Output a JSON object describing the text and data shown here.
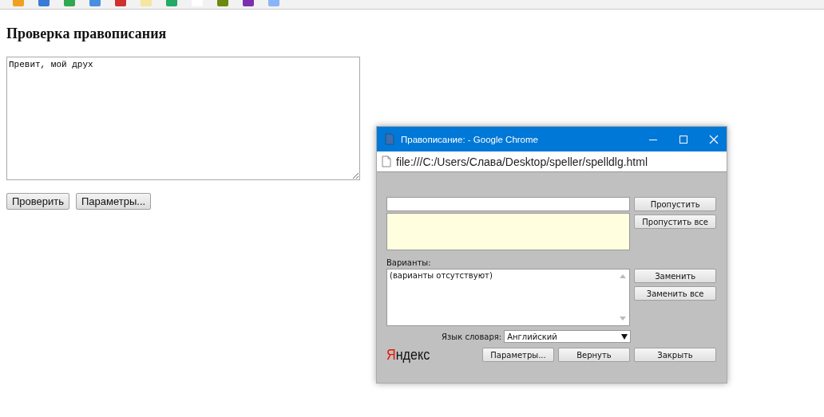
{
  "page": {
    "heading": "Проверка правописания",
    "text": "Превит, мой друх",
    "buttons": [
      "Проверить",
      "Параметры..."
    ]
  },
  "dialog": {
    "title": "Правописание: - Google Chrome",
    "url": "file:///C:/Users/Слава/Desktop/speller/spelldlg.html",
    "skip_buttons": [
      "Пропустить",
      "Пропустить все"
    ],
    "variants_label": "Варианты:",
    "variants_text": "(варианты отсутствуют)",
    "replace_buttons": [
      "Заменить",
      "Заменить все"
    ],
    "language_label": "Язык словаря:",
    "language": "Английский",
    "logo": "Яндекс",
    "bottom_buttons": [
      "Параметры...",
      "Вернуть",
      "Закрыть"
    ]
  }
}
